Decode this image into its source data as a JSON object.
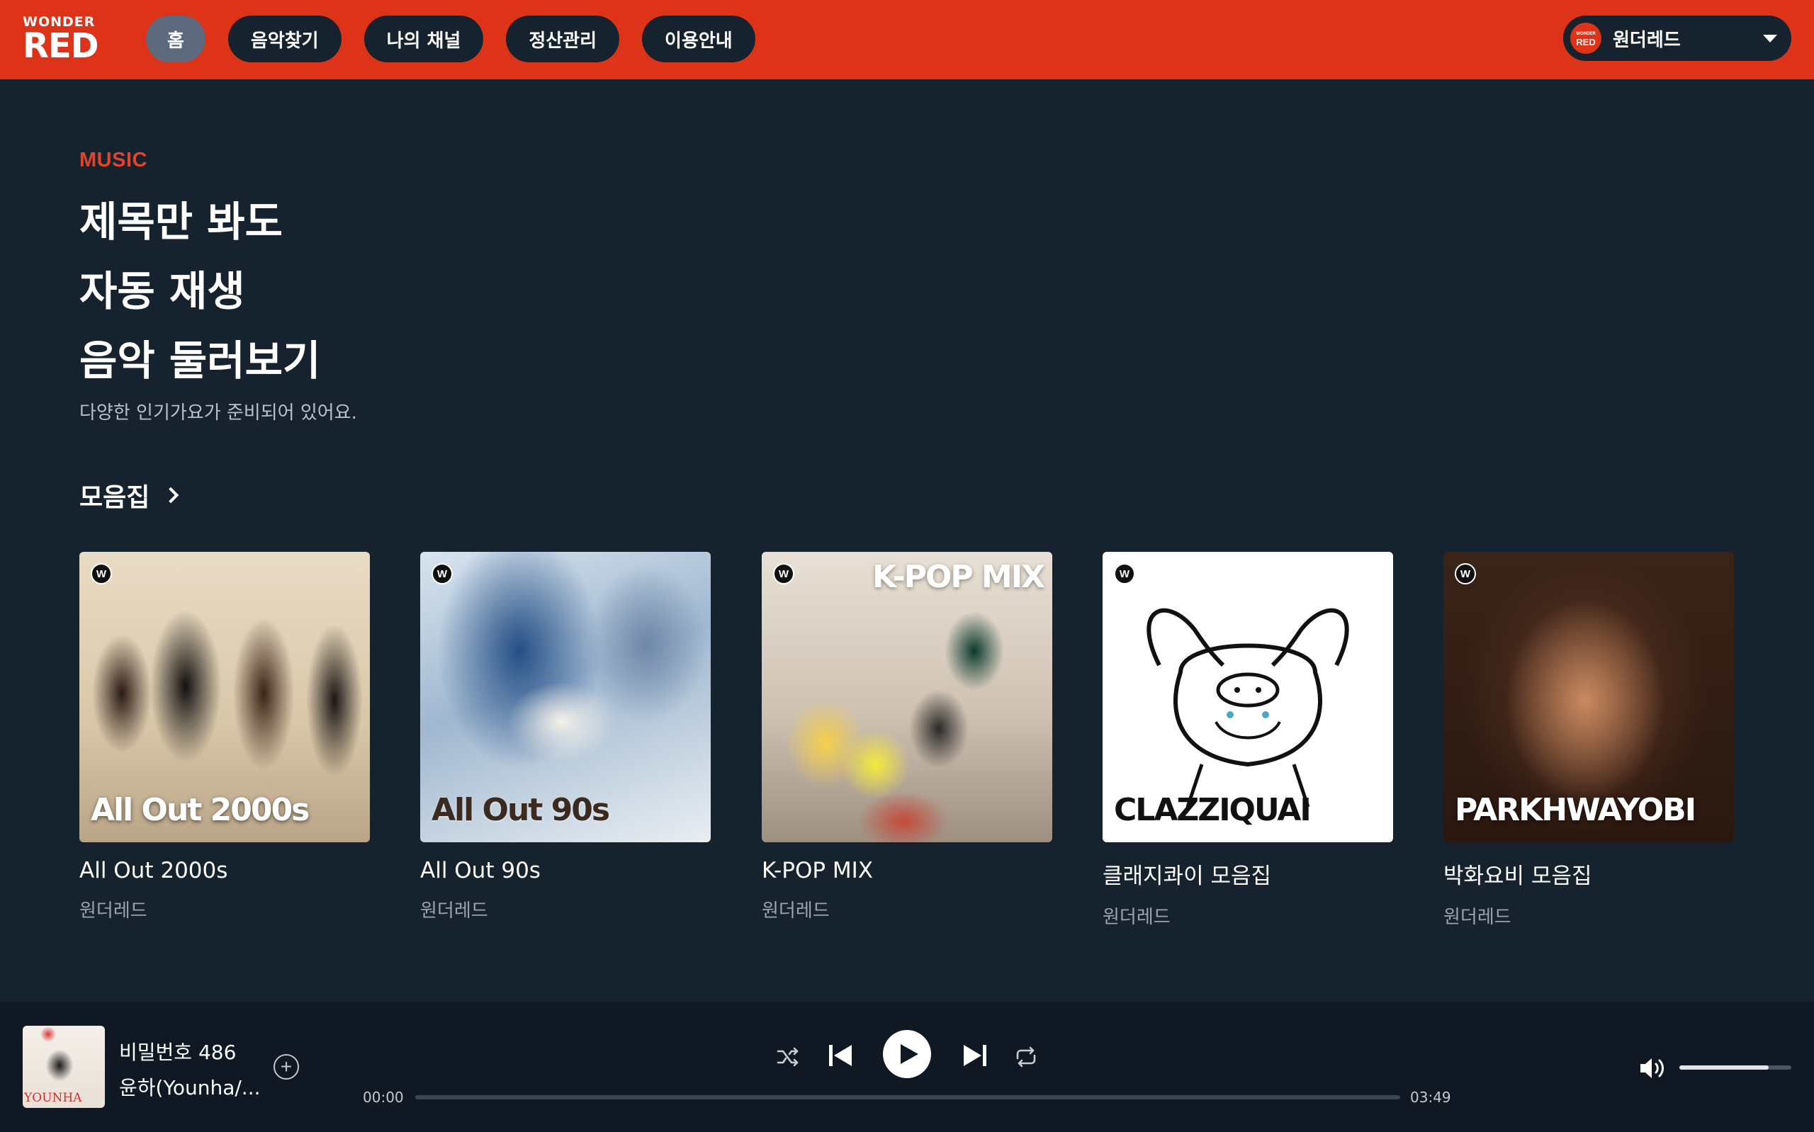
{
  "header": {
    "logo_top": "WONDER",
    "logo_bottom": "RED",
    "nav": [
      {
        "label": "홈",
        "active": true
      },
      {
        "label": "음악찾기",
        "active": false
      },
      {
        "label": "나의 채널",
        "active": false
      },
      {
        "label": "정산관리",
        "active": false
      },
      {
        "label": "이용안내",
        "active": false
      }
    ],
    "account": {
      "avatar_top": "WONDER",
      "avatar_bottom": "RED",
      "name": "원더레드"
    },
    "accent_color": "#dd3318"
  },
  "hero": {
    "eyebrow": "MUSIC",
    "title_lines": [
      "제목만 봐도",
      "자동 재생",
      "음악 둘러보기"
    ],
    "subtitle": "다양한 인기가요가 준비되어 있어요."
  },
  "section": {
    "title": "모음집",
    "cards": [
      {
        "cover_text": "All Out 2000s",
        "title": "All Out 2000s",
        "subtitle": "원더레드",
        "badge": "W"
      },
      {
        "cover_text": "All Out 90s",
        "title": "All Out 90s",
        "subtitle": "원더레드",
        "badge": "W"
      },
      {
        "cover_text": "K-POP MIX",
        "title": "K-POP MIX",
        "subtitle": "원더레드",
        "badge": "W"
      },
      {
        "cover_text": "CLAZZIQUAI",
        "title": "클래지콰이 모음집",
        "subtitle": "원더레드",
        "badge": "W"
      },
      {
        "cover_text": "PARKHWAYOBI",
        "title": "박화요비 모음집",
        "subtitle": "원더레드",
        "badge": "W"
      }
    ]
  },
  "player": {
    "track_title": "비밀번호 486",
    "artist": "윤하(Younha/...",
    "album_art_text": "YOUNHA",
    "current_time": "00:00",
    "duration": "03:49",
    "progress_fraction": 0.0,
    "volume_fraction": 0.8,
    "icons": [
      "add-icon",
      "shuffle-icon",
      "previous-icon",
      "play-icon",
      "next-icon",
      "repeat-icon",
      "volume-icon"
    ]
  }
}
